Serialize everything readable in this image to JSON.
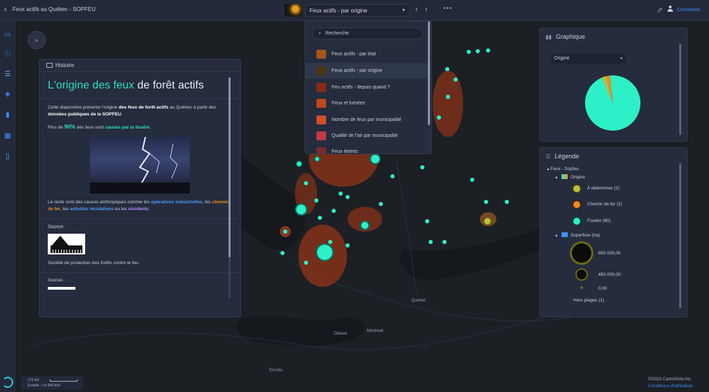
{
  "topbar": {
    "back_icon": "‹",
    "app_title": "Feux actifs au Québec - SOPFEU",
    "theme_selected": "Feux actifs - par origine",
    "chevron": "▾",
    "prev": "‹",
    "next": "›",
    "more": "•••",
    "share_icon": "⇗",
    "login_label": "Connexion"
  },
  "rail": {
    "icons": [
      "map-icon",
      "info-icon",
      "list-icon",
      "layers-icon",
      "chart-icon",
      "table-icon",
      "book-icon"
    ]
  },
  "story": {
    "header": "Histoire",
    "title_part1": "L'origine des feux",
    "title_part2": " de forêt actifs",
    "intro_1": "Cette diapositive présente l'origine ",
    "intro_bold_1": "des feux de forêt actifs",
    "intro_2": " au Québec à partir des ",
    "intro_bold_2": "données publiques de la SOPFEU",
    "intro_3": ".",
    "stat_1": "Plus de ",
    "stat_pct": "90%",
    "stat_2": " des feux sont ",
    "stat_cause": "causés par la foudre",
    "stat_3": ".",
    "rest_1": "Le reste sont des causes anthropiques comme les ",
    "rest_industrial": "opérations industrielles",
    "rest_2": ", les ",
    "rest_rail": "chemins de fer",
    "rest_3": ", les ",
    "rest_recreation": "activités récréatives",
    "rest_4": " ou les ",
    "rest_residents": "résidents",
    "rest_5": ".",
    "source_label": "Source:",
    "logo_text": "SOPFEU",
    "logo_sub": "Société de protection",
    "source_desc": "Société de protection des forêts contre le feu.",
    "sources_label": "Sources :"
  },
  "menu": {
    "search_placeholder": "Recherche",
    "search_icon": "⌕",
    "items": [
      {
        "label": "Feux actifs - par état",
        "color": "#a5581a"
      },
      {
        "label": "Feux actifs - par origine",
        "color": "#4a3412"
      },
      {
        "label": "Feu actifs - depuis quand ?",
        "color": "#8a2a14"
      },
      {
        "label": "Feux et fumées",
        "color": "#c0481e"
      },
      {
        "label": "Nombre de feux par municipalité",
        "color": "#d0502a"
      },
      {
        "label": "Qualité de l'air par municipalité",
        "color": "#c03a44"
      },
      {
        "label": "Feux éteints",
        "color": "#7a2c30"
      }
    ]
  },
  "chart_panel": {
    "title": "Graphique",
    "title_icon": "▮▮",
    "select_value": "Origine",
    "chevron": "▾"
  },
  "chart_data": {
    "type": "pie",
    "slices": [
      {
        "label": "Foudre",
        "value": 80,
        "color": "#2ef0c8"
      },
      {
        "label": "À déterminer",
        "value": 2,
        "color": "#b8c23a"
      },
      {
        "label": "Chemin de fer",
        "value": 2,
        "color": "#f08a24"
      }
    ]
  },
  "legend_panel": {
    "title": "Légende",
    "title_icon": "☰",
    "layer_name": "Feux - Sopfeu",
    "group_origin": "Origine",
    "entries": [
      {
        "label": "À déterminer (2)",
        "color": "#b8c23a"
      },
      {
        "label": "Chemin de fer (2)",
        "color": "#f08a24"
      },
      {
        "label": "Foudre (80)",
        "color": "#2ef0c8"
      }
    ],
    "group_size": "Superficie (ha)",
    "sizes": [
      {
        "label": "900 000,00"
      },
      {
        "label": "450 000,00"
      },
      {
        "label": "0,00"
      }
    ],
    "out_of_range": "Hors plages (1)"
  },
  "map_labels": {
    "ottawa": "Ottawa",
    "quebec": "Quebec",
    "toronto": "Toronto",
    "montreal": "Montreal"
  },
  "footer": {
    "scale_distance": "172 km",
    "scale_ratio": "Échelle : 1:6 960 694",
    "copyright": "©2022 CartoVista inc.",
    "terms": "Conditions d'utilisation"
  }
}
